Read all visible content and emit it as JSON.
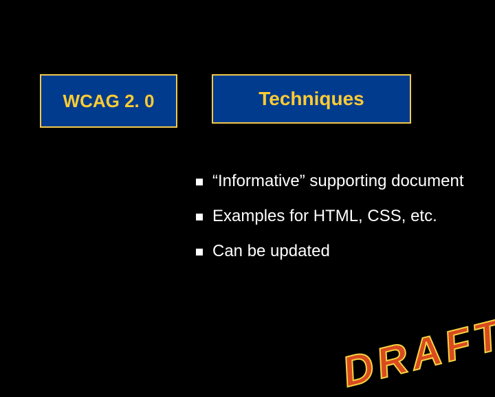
{
  "boxes": {
    "wcag_label": "WCAG 2. 0",
    "techniques_label": "Techniques"
  },
  "bullets": [
    "“Informative” supporting document",
    "Examples for HTML, CSS, etc.",
    "Can be updated"
  ],
  "watermark": "DRAFT"
}
